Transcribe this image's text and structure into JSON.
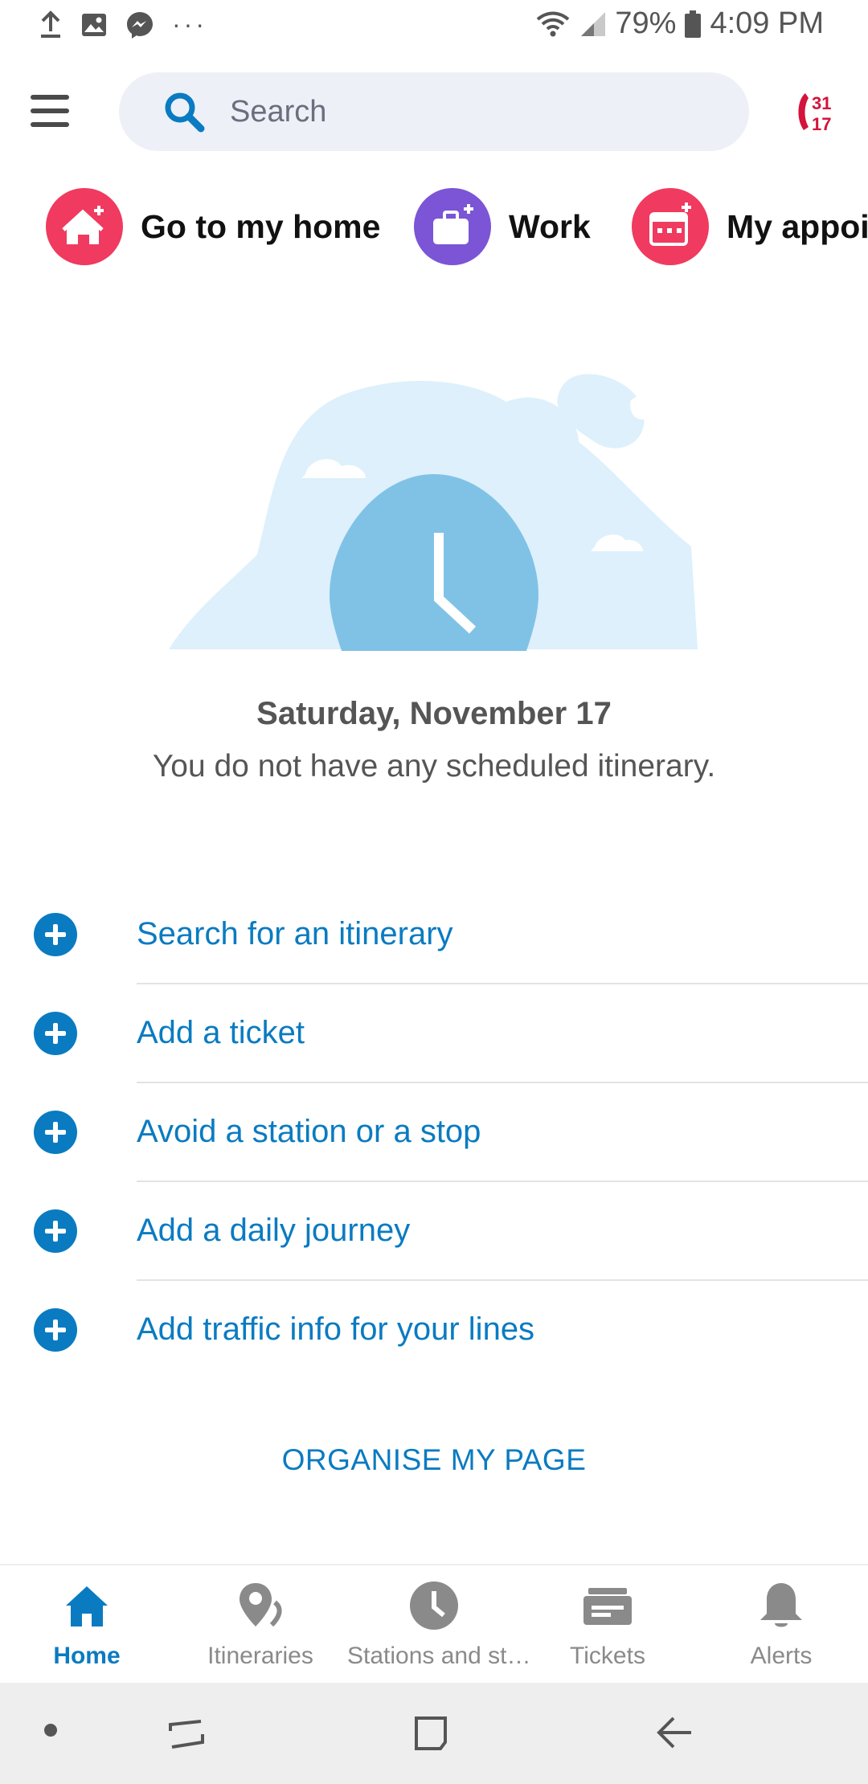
{
  "status_bar": {
    "dots": "···",
    "battery_pct": "79%",
    "time": "4:09 PM",
    "notif_icons": [
      "upload-icon",
      "image-icon",
      "messenger-icon"
    ]
  },
  "search": {
    "placeholder": "Search"
  },
  "shortcuts": [
    {
      "label": "Go to my home",
      "icon": "home-plus-icon",
      "color": "#f03a5f"
    },
    {
      "label": "Work",
      "icon": "briefcase-plus-icon",
      "color": "#7b55d6"
    },
    {
      "label": "My appoi",
      "icon": "calendar-plus-icon",
      "color": "#f03a5f"
    }
  ],
  "schedule": {
    "date": "Saturday, November 17",
    "message": "You do not have any scheduled itinerary."
  },
  "actions": [
    {
      "label": "Search for an itinerary"
    },
    {
      "label": "Add a ticket"
    },
    {
      "label": "Avoid a station or a stop"
    },
    {
      "label": "Add a daily journey"
    },
    {
      "label": "Add traffic info for your lines"
    }
  ],
  "organise_label": "ORGANISE MY PAGE",
  "bottom_nav": [
    {
      "label": "Home",
      "icon": "home-icon",
      "active": true
    },
    {
      "label": "Itineraries",
      "icon": "itinerary-pin-icon",
      "active": false
    },
    {
      "label": "Stations and st…",
      "icon": "clock-icon",
      "active": false
    },
    {
      "label": "Tickets",
      "icon": "ticket-icon",
      "active": false
    },
    {
      "label": "Alerts",
      "icon": "bell-icon",
      "active": false
    }
  ],
  "colors": {
    "accent_blue": "#0a7bc1",
    "hotline_red": "#d3143c",
    "nav_inactive": "#8a8a8a"
  },
  "hotline": {
    "top": "31",
    "bottom": "17"
  }
}
